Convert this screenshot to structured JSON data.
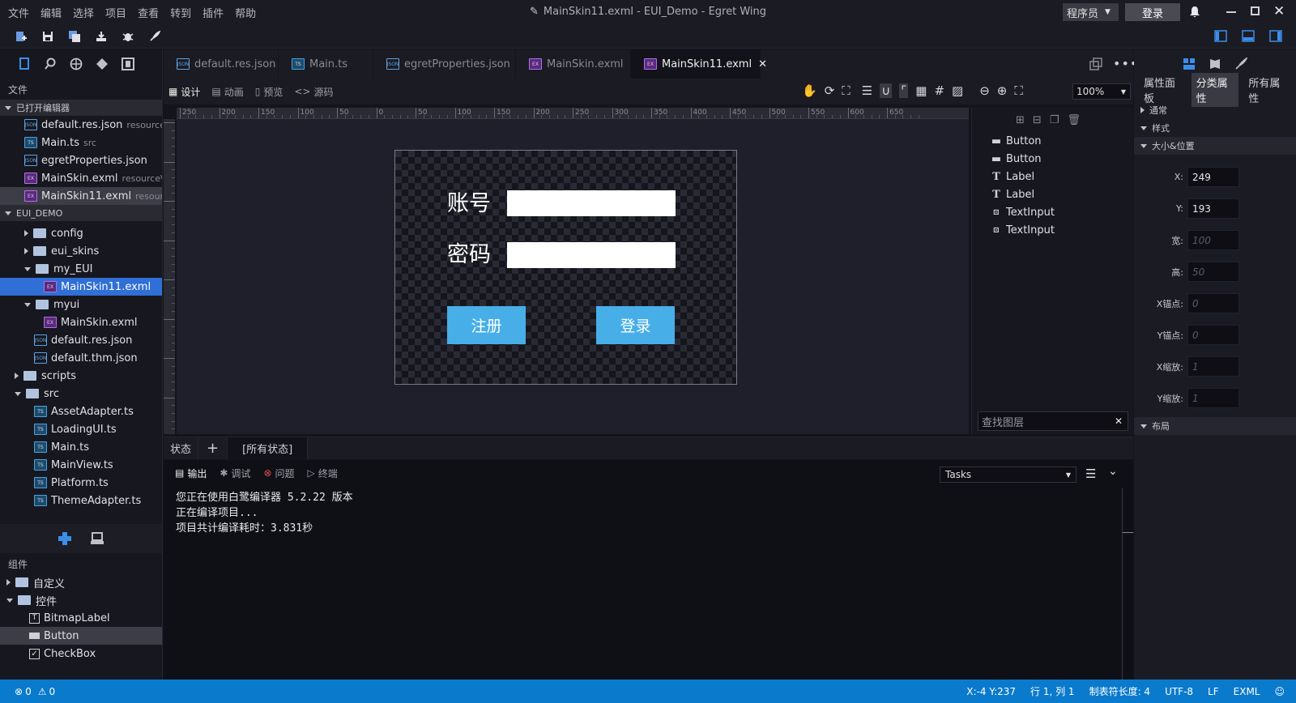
{
  "menu": [
    "文件",
    "编辑",
    "选择",
    "项目",
    "查看",
    "转到",
    "插件",
    "帮助"
  ],
  "window_title": "MainSkin11.exml - EUI_Demo - Egret Wing",
  "role": "程序员",
  "login_label": "登录",
  "left_panel": {
    "files_caption": "文件",
    "open_editors_header": "已打开编辑器",
    "open_editors": [
      {
        "name": "default.res.json",
        "sub": "resource",
        "icon": "json"
      },
      {
        "name": "Main.ts",
        "sub": "src",
        "icon": "ts"
      },
      {
        "name": "egretProperties.json",
        "sub": "",
        "icon": "json"
      },
      {
        "name": "MainSkin.exml",
        "sub": "resource\\...",
        "icon": "exml"
      },
      {
        "name": "MainSkin11.exml",
        "sub": "resour...",
        "icon": "exml"
      }
    ],
    "project_header": "EUI_DEMO",
    "tree": [
      {
        "name": "config",
        "type": "folder"
      },
      {
        "name": "eui_skins",
        "type": "folder"
      },
      {
        "name": "my_EUI",
        "type": "folder"
      },
      {
        "name": "MainSkin11.exml",
        "type": "exml"
      },
      {
        "name": "myui",
        "type": "folder"
      },
      {
        "name": "MainSkin.exml",
        "type": "exml"
      },
      {
        "name": "default.res.json",
        "type": "json"
      },
      {
        "name": "default.thm.json",
        "type": "json"
      },
      {
        "name": "scripts",
        "type": "folder"
      },
      {
        "name": "src",
        "type": "folder"
      },
      {
        "name": "AssetAdapter.ts",
        "type": "ts"
      },
      {
        "name": "LoadingUI.ts",
        "type": "ts"
      },
      {
        "name": "Main.ts",
        "type": "ts"
      },
      {
        "name": "MainView.ts",
        "type": "ts"
      },
      {
        "name": "Platform.ts",
        "type": "ts"
      },
      {
        "name": "ThemeAdapter.ts",
        "type": "ts"
      }
    ],
    "components_caption": "组件",
    "components": [
      {
        "name": "自定义",
        "type": "folder"
      },
      {
        "name": "控件",
        "type": "folder"
      },
      {
        "name": "BitmapLabel",
        "type": "item"
      },
      {
        "name": "Button",
        "type": "item"
      },
      {
        "name": "CheckBox",
        "type": "item"
      }
    ]
  },
  "tabs": [
    {
      "label": "default.res.json",
      "icon": "json"
    },
    {
      "label": "Main.ts",
      "icon": "ts"
    },
    {
      "label": "egretProperties.json",
      "icon": "json"
    },
    {
      "label": "MainSkin.exml",
      "icon": "exml"
    },
    {
      "label": "MainSkin11.exml",
      "icon": "exml"
    }
  ],
  "modes": [
    "设计",
    "动画",
    "预览",
    "源码"
  ],
  "zoom": "100%",
  "ruler_top_labels": [
    "250",
    "200",
    "150",
    "100",
    "50",
    "0",
    "50",
    "100",
    "150",
    "200",
    "250",
    "300",
    "350",
    "400",
    "450",
    "500",
    "550",
    "600",
    "650"
  ],
  "skin": {
    "account_label": "账号",
    "password_label": "密码",
    "register_button": "注册",
    "login_button": "登录"
  },
  "layers": [
    {
      "name": "Button",
      "icon": "button"
    },
    {
      "name": "Button",
      "icon": "button"
    },
    {
      "name": "Label",
      "icon": "label"
    },
    {
      "name": "Label",
      "icon": "label"
    },
    {
      "name": "TextInput",
      "icon": "textinput"
    },
    {
      "name": "TextInput",
      "icon": "textinput"
    }
  ],
  "find_layer_placeholder": "查找图层",
  "state_bar": {
    "label": "状态",
    "all_states": "[所有状态]"
  },
  "output_tabs": [
    "输出",
    "调试",
    "问题",
    "终端"
  ],
  "tasks": "Tasks",
  "output_lines": [
    "您正在使用白鹭编译器 5.2.22 版本",
    "正在编译项目...",
    "项目共计编译耗时：3.831秒"
  ],
  "right_panel": {
    "tabs": [
      "属性面板",
      "分类属性",
      "所有属性"
    ],
    "groups": {
      "general": "通常",
      "style": "样式",
      "size_pos": "大小&位置",
      "layout": "布局"
    },
    "props": [
      {
        "label": "X:",
        "value": "249",
        "placeholder": false
      },
      {
        "label": "Y:",
        "value": "193",
        "placeholder": false
      },
      {
        "label": "宽:",
        "value": "100",
        "placeholder": true
      },
      {
        "label": "高:",
        "value": "50",
        "placeholder": true
      },
      {
        "label": "X锚点:",
        "value": "0",
        "placeholder": true
      },
      {
        "label": "Y锚点:",
        "value": "0",
        "placeholder": true
      },
      {
        "label": "X缩放:",
        "value": "1",
        "placeholder": true
      },
      {
        "label": "Y缩放:",
        "value": "1",
        "placeholder": true
      }
    ]
  },
  "status": {
    "errors": "0",
    "warnings": "0",
    "coords": "X:-4 Y:237",
    "position": "行 1, 列 1",
    "tab_size": "制表符长度: 4",
    "encoding": "UTF-8",
    "eol": "LF",
    "language": "EXML"
  },
  "colors": {
    "accent": "#2f6fd6",
    "status_bar": "#0a7acc",
    "skin_button": "#47aee8"
  }
}
